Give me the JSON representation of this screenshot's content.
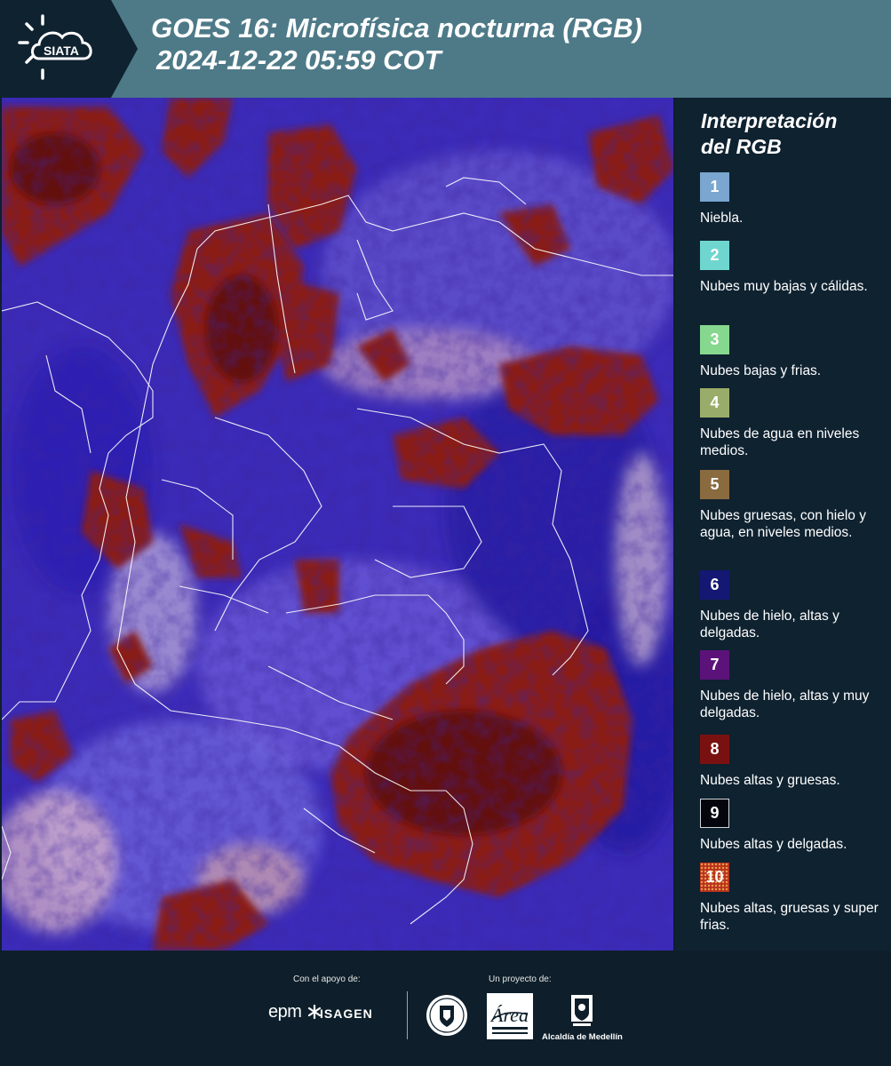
{
  "header": {
    "logo_text": "SIATA",
    "title_line1": "GOES 16: Microfísica nocturna (RGB)",
    "title_line2": "2024-12-22 05:59 COT"
  },
  "legend": {
    "title_line1": "Interpretación",
    "title_line2": "del RGB",
    "items": [
      {
        "num": "1",
        "label": "Niebla.",
        "color": "#7aa6cf"
      },
      {
        "num": "2",
        "label": "Nubes muy bajas y cálidas.",
        "color": "#6fd6cf"
      },
      {
        "num": "3",
        "label": "Nubes bajas y frias.",
        "color": "#86d88e"
      },
      {
        "num": "4",
        "label": "Nubes de agua en niveles medios.",
        "color": "#9aac6a"
      },
      {
        "num": "5",
        "label": "Nubes gruesas, con hielo y agua, en niveles medios.",
        "color": "#8a6a3f"
      },
      {
        "num": "6",
        "label": "Nubes de hielo, altas y delgadas.",
        "color": "#141873"
      },
      {
        "num": "7",
        "label": "Nubes de hielo, altas y muy delgadas.",
        "color": "#5b137a"
      },
      {
        "num": "8",
        "label": "Nubes altas y gruesas.",
        "color": "#7a1111"
      },
      {
        "num": "9",
        "label": "Nubes altas y delgadas.",
        "color": "#05050d"
      },
      {
        "num": "10",
        "label": "Nubes altas, gruesas y super frias.",
        "color": "#b8321e"
      }
    ]
  },
  "footer": {
    "support_label": "Con el apoyo de:",
    "project_label": "Un proyecto de:",
    "epm_logo": "epm",
    "isagen_logo": "ISAGEN",
    "area_logo": "Área",
    "alcaldia_logo": "Alcaldía de Medellín"
  }
}
